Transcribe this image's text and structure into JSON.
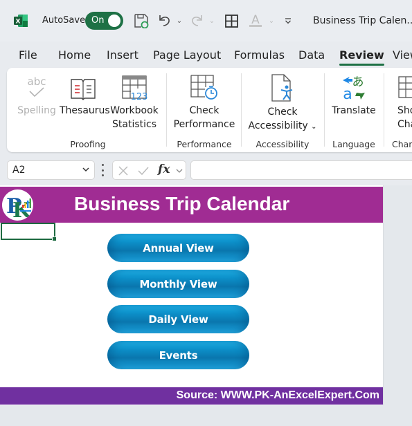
{
  "titlebar": {
    "app_icon": "excel-icon",
    "autosave_label": "AutoSave",
    "autosave_state": "On",
    "quick_access": [
      "save-icon",
      "undo-icon",
      "redo-icon",
      "borders-icon",
      "font-color-icon",
      "customize-qat-icon"
    ],
    "document_title": "Business Trip Calen..."
  },
  "tabs": [
    {
      "label": "File",
      "active": false
    },
    {
      "label": "Home",
      "active": false
    },
    {
      "label": "Insert",
      "active": false
    },
    {
      "label": "Page Layout",
      "active": false
    },
    {
      "label": "Formulas",
      "active": false
    },
    {
      "label": "Data",
      "active": false
    },
    {
      "label": "Review",
      "active": true
    },
    {
      "label": "View",
      "active": false
    }
  ],
  "ribbon": {
    "groups": [
      {
        "label": "Proofing",
        "buttons": [
          {
            "label": "Spelling",
            "icon": "spelling-icon",
            "disabled": true
          },
          {
            "label": "Thesaurus",
            "icon": "thesaurus-icon"
          },
          {
            "label_line1": "Workbook",
            "label_line2": "Statistics",
            "icon": "workbook-statistics-icon"
          }
        ]
      },
      {
        "label": "Performance",
        "buttons": [
          {
            "label_line1": "Check",
            "label_line2": "Performance",
            "icon": "check-performance-icon"
          }
        ]
      },
      {
        "label": "Accessibility",
        "buttons": [
          {
            "label_line1": "Check",
            "label_line2": "Accessibility",
            "icon": "check-accessibility-icon",
            "dropdown": true
          }
        ]
      },
      {
        "label": "Language",
        "buttons": [
          {
            "label": "Translate",
            "icon": "translate-icon"
          }
        ]
      },
      {
        "label": "Chan",
        "buttons": [
          {
            "label_line1": "Sho",
            "label_line2": "Chan",
            "icon": "show-changes-icon"
          }
        ]
      }
    ]
  },
  "formula_bar": {
    "name_box": "A2",
    "formula_value": ""
  },
  "sheet": {
    "title": "Business Trip Calendar",
    "nav_buttons": [
      "Annual View",
      "Monthly View",
      "Daily View",
      "Events"
    ],
    "footer": "Source: WWW.PK-AnExcelExpert.Com",
    "colors": {
      "header": "#a02c93",
      "footer": "#7030a0",
      "button": "#0a7fb8",
      "accent": "#1e7145"
    }
  }
}
